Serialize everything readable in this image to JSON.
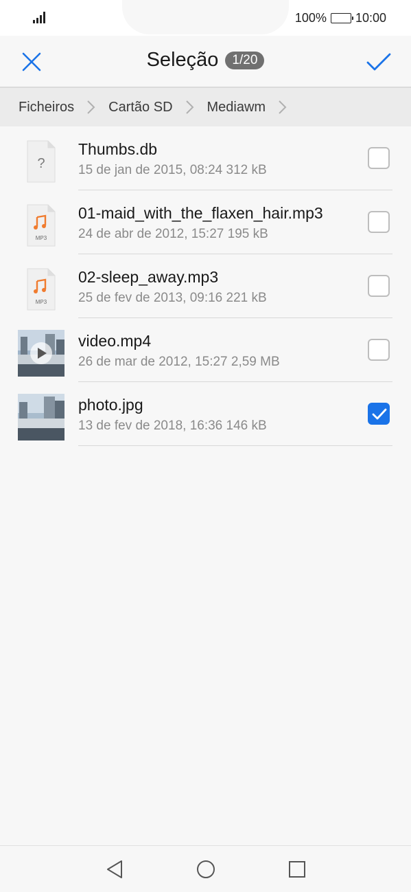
{
  "status": {
    "battery_text": "100%",
    "time": "10:00"
  },
  "header": {
    "title": "Seleção",
    "count": "1/20"
  },
  "breadcrumb": [
    "Ficheiros",
    "Cartão SD",
    "Mediawm"
  ],
  "files": [
    {
      "name": "Thumbs.db",
      "meta": "15 de jan de 2015, 08:24 312 kB",
      "icon": "unknown-file-icon",
      "checked": false
    },
    {
      "name": "01-maid_with_the_flaxen_hair.mp3",
      "meta": "24 de abr de 2012, 15:27 195 kB",
      "icon": "mp3-file-icon",
      "icon_label": "MP3",
      "checked": false
    },
    {
      "name": "02-sleep_away.mp3",
      "meta": "25 de fev de 2013, 09:16 221 kB",
      "icon": "mp3-file-icon",
      "icon_label": "MP3",
      "checked": false
    },
    {
      "name": "video.mp4",
      "meta": "26 de mar de 2012, 15:27 2,59 MB",
      "icon": "video-thumbnail",
      "checked": false
    },
    {
      "name": "photo.jpg",
      "meta": "13 de fev de 2018, 16:36 146 kB",
      "icon": "photo-thumbnail",
      "checked": true
    }
  ],
  "colors": {
    "accent": "#1a73e8",
    "badge": "#707070"
  }
}
